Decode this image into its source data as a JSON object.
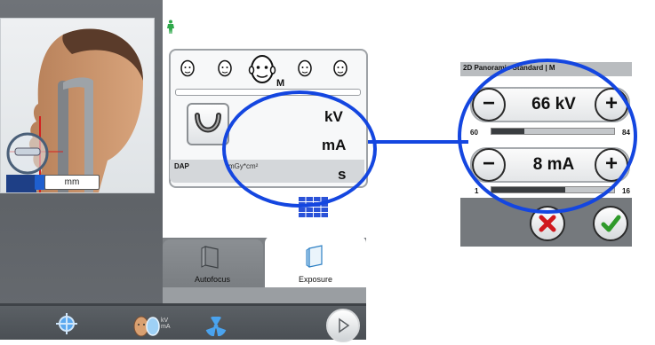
{
  "patient_view": {
    "ruler_unit": "mm"
  },
  "program": {
    "size_label": "M",
    "units": {
      "kv": "kV",
      "ma": "mA",
      "time": "s"
    },
    "dap": {
      "label": "DAP",
      "unit": "mGy*cm²"
    }
  },
  "tabs": [
    {
      "label": "Autofocus"
    },
    {
      "label": "Exposure"
    }
  ],
  "toolbar": {
    "kv_line1": "kV",
    "kv_line2": "mA"
  },
  "zoom": {
    "title": "2D Panoramic Standard | M",
    "kv": {
      "value": "66 kV",
      "min": "60",
      "max": "84",
      "level": 0.27
    },
    "ma": {
      "value": "8 mA",
      "min": "1",
      "max": "16",
      "level": 0.6
    }
  },
  "colors": {
    "callout": "#1446e0",
    "cancel": "#d0181e",
    "confirm": "#2f9a2a",
    "person_icon": "#2ea84a",
    "grid_icon": "#2a52d8"
  },
  "icons": [
    "person-icon",
    "head-icon",
    "dental-arch-icon",
    "grid-icon",
    "crosshair-icon",
    "face-icon",
    "radiation-icon",
    "play-icon",
    "minus-icon",
    "plus-icon",
    "cancel-icon",
    "confirm-icon"
  ]
}
